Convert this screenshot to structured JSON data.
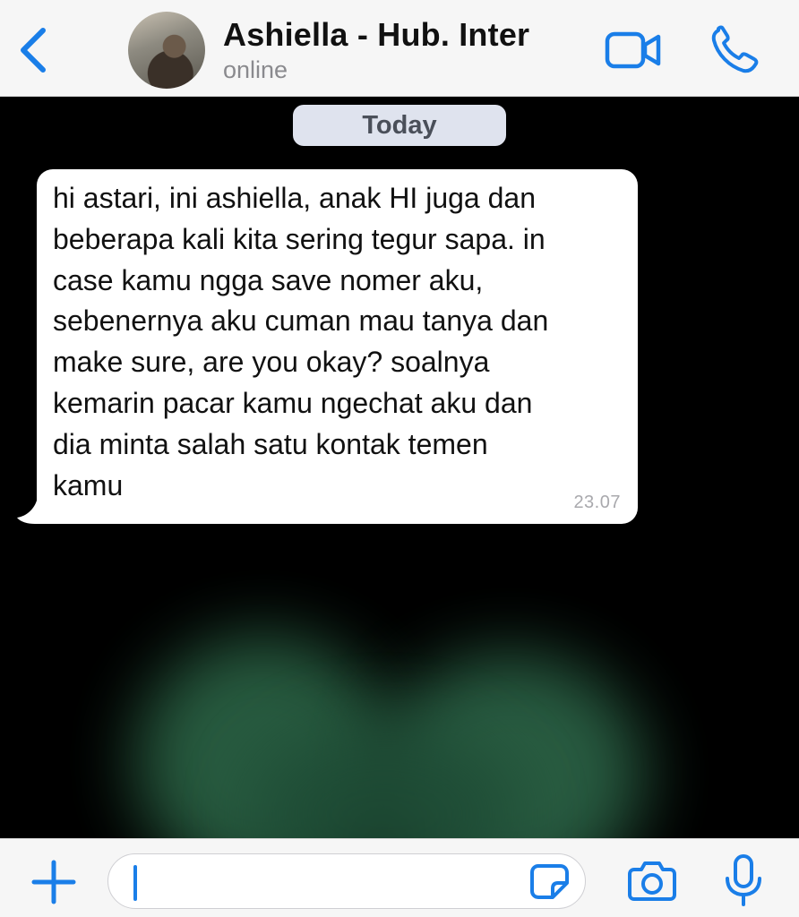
{
  "colors": {
    "accent": "#1a7ee8",
    "header_bg": "#f6f6f6",
    "chat_bg": "#000000",
    "bubble_bg": "#ffffff"
  },
  "header": {
    "back_icon": "chevron-left-icon",
    "contact_name": "Ashiella - Hub. Inter",
    "status": "online",
    "video_icon": "video-camera-icon",
    "call_icon": "phone-icon"
  },
  "chat": {
    "date_separator": "Today",
    "messages": [
      {
        "text": "hi astari, ini ashiella, anak HI juga dan\nbeberapa kali kita sering tegur sapa. in\ncase kamu ngga save nomer aku,\nsebenernya aku cuman mau tanya dan\nmake sure, are you okay? soalnya\nkemarin pacar kamu ngechat aku dan\ndia minta salah satu kontak temen\nkamu",
        "time": "23.07",
        "direction": "incoming"
      }
    ]
  },
  "input_bar": {
    "plus_icon": "plus-icon",
    "message_value": "",
    "sticker_icon": "sticker-icon",
    "camera_icon": "camera-icon",
    "mic_icon": "microphone-icon"
  }
}
